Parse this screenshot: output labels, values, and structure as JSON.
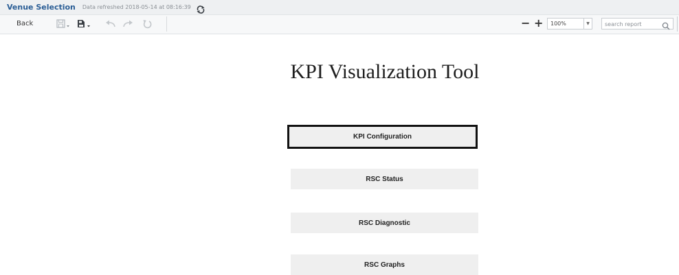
{
  "header": {
    "title": "Venue Selection",
    "refresh_text": "Data refreshed 2018-05-14 at 08:16:39"
  },
  "toolbar": {
    "back_label": "Back",
    "zoom_minus": "−",
    "zoom_plus": "+",
    "zoom_value": "100%",
    "search_placeholder": "search report"
  },
  "main": {
    "title": "KPI Visualization Tool",
    "buttons": [
      {
        "label": "KPI Configuration",
        "focused": true
      },
      {
        "label": "RSC Status"
      },
      {
        "label": "RSC Diagnostic"
      },
      {
        "label": "RSC Graphs"
      }
    ]
  },
  "colors": {
    "title_blue": "#2a5d95",
    "button_bg": "#efefef",
    "focus_border": "#111111"
  }
}
